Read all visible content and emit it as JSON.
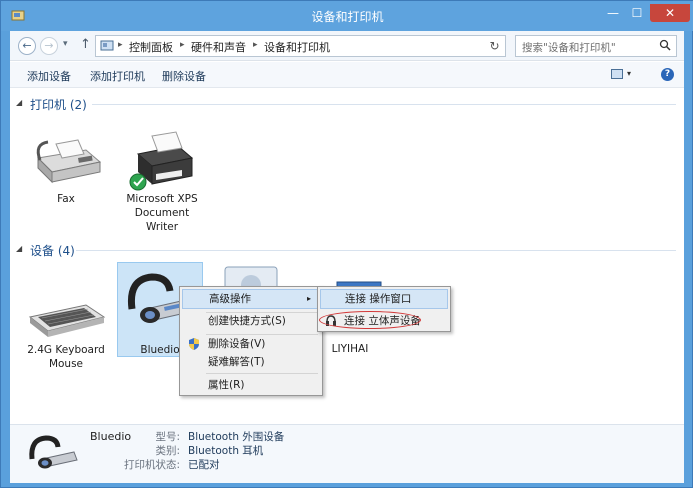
{
  "window": {
    "title": "设备和打印机",
    "min": "—",
    "max": "☐",
    "close": "✕"
  },
  "nav": {
    "back": "←",
    "forward": "→",
    "recent": "▾",
    "up": "↑",
    "refresh": "↻",
    "dropdown": "▾"
  },
  "address": {
    "crumbs": [
      "控制面板",
      "硬件和声音",
      "设备和打印机"
    ],
    "sep": "▸"
  },
  "search": {
    "placeholder": "搜索\"设备和打印机\""
  },
  "toolbar": {
    "add_device": "添加设备",
    "add_printer": "添加打印机",
    "remove_device": "删除设备",
    "view_dd": "▾",
    "help": "?"
  },
  "groups": {
    "printers": {
      "arrow": "◢",
      "title": "打印机 (2)"
    },
    "devices": {
      "arrow": "◢",
      "title": "设备 (4)"
    }
  },
  "printers": [
    {
      "lines": [
        "Fax"
      ]
    },
    {
      "lines": [
        "Microsoft XPS",
        "Document",
        "Writer"
      ]
    }
  ],
  "devices": [
    {
      "lines": [
        "2.4G Keyboard",
        "Mouse"
      ]
    },
    {
      "lines": [
        "Bluedio"
      ]
    },
    {
      "lines": [
        "LIYIHAI"
      ]
    }
  ],
  "context_menu": {
    "advanced": "高级操作",
    "arrow": "▸",
    "create_shortcut": "创建快捷方式(S)",
    "remove_device": "删除设备(V)",
    "troubleshoot": "疑难解答(T)",
    "properties": "属性(R)"
  },
  "submenu": {
    "connect_window": "连接 操作窗口",
    "connect_stereo": "连接 立体声设备"
  },
  "details": {
    "name": "Bluedio",
    "rows": [
      {
        "key": "型号:",
        "value": "Bluetooth 外围设备"
      },
      {
        "key": "类别:",
        "value": "Bluetooth 耳机"
      },
      {
        "key": "打印机状态:",
        "value": "已配对"
      }
    ]
  },
  "colors": {
    "accent": "#5ea3de",
    "selection": "#cce4f7",
    "close": "#c7463c",
    "annotation": "#d23a3a"
  }
}
